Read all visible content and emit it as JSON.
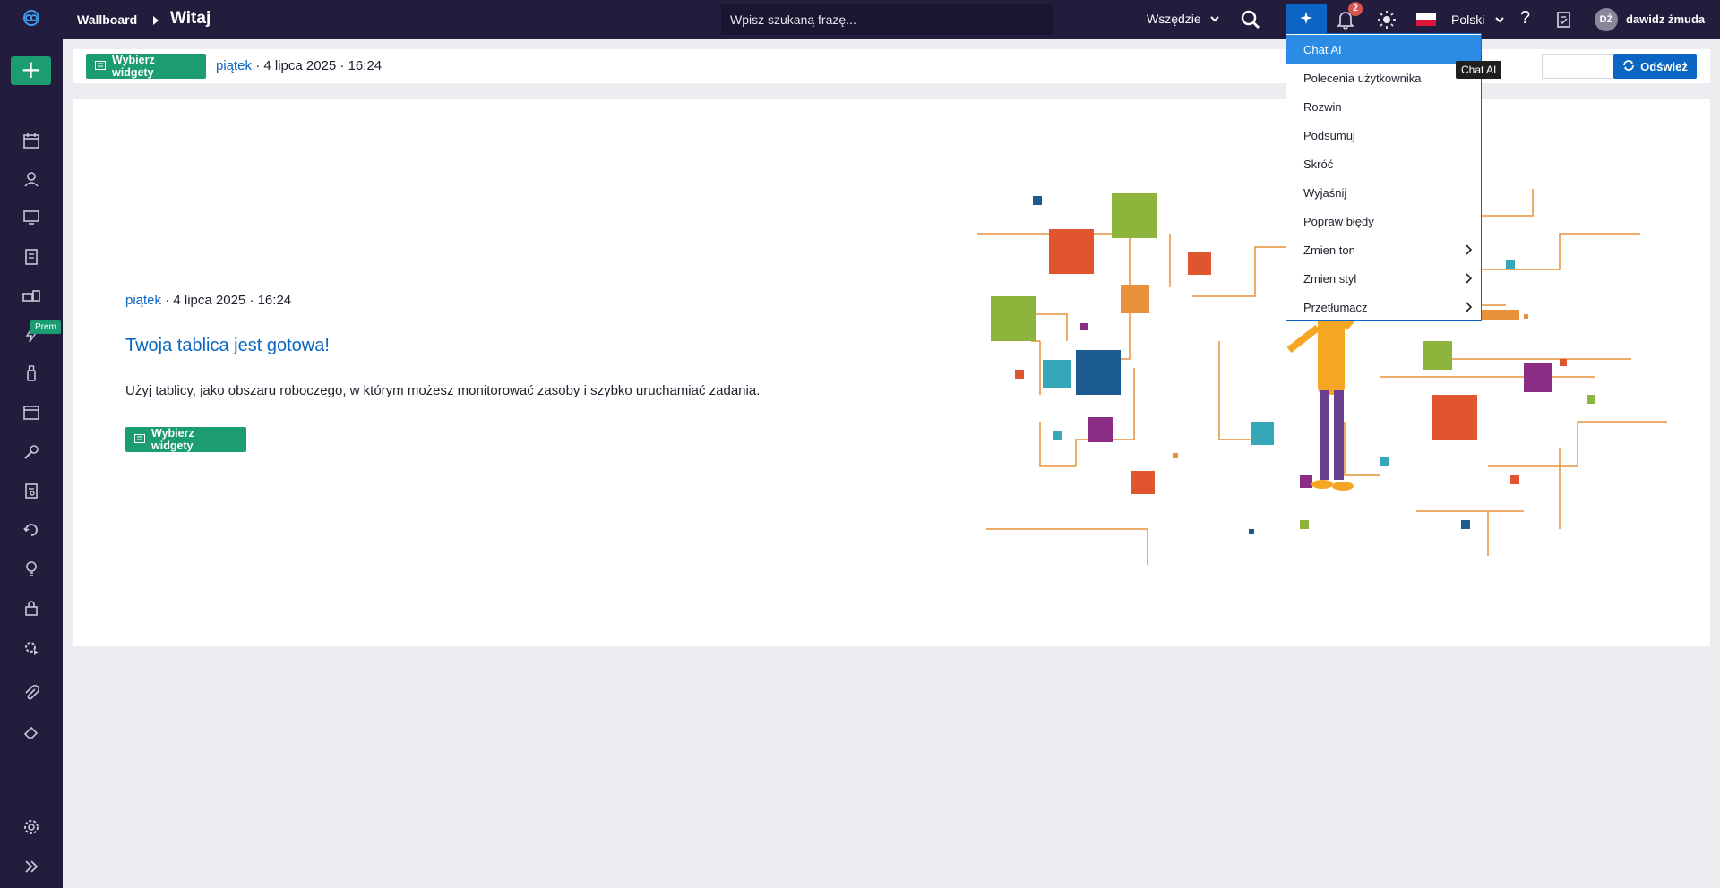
{
  "header": {
    "breadcrumb_root": "Wallboard",
    "breadcrumb_current": "Witaj",
    "search_placeholder": "Wpisz szukaną frazę...",
    "search_scope": "Wszędzie",
    "notification_count": "2",
    "language": "Polski",
    "help": "?",
    "user_initials": "DŻ",
    "user_name": "dawidz żmuda"
  },
  "sidebar": {
    "add": "+",
    "prem_badge": "Prem",
    "icons": [
      "calendar-icon",
      "user-icon",
      "monitor-icon",
      "document-icon",
      "network-icon",
      "lightning-icon",
      "usb-icon",
      "window-icon",
      "wrench-icon",
      "clipboard-icon",
      "refresh-icon",
      "lightbulb-icon",
      "lock-icon",
      "gear-play-icon",
      "paperclip-icon",
      "eraser-icon",
      "settings-icon",
      "expand-icon"
    ]
  },
  "toolbar": {
    "choose_widgets": "Wybierz widgety",
    "day": "piątek",
    "date_rest": " · 4 lipca 2025 · 16:24",
    "refresh": "Odśwież"
  },
  "welcome": {
    "day": "piątek",
    "date_rest": " · 4 lipca 2025 · 16:24",
    "title": "Twoja tablica jest gotowa!",
    "description": "Użyj tablicy, jako obszaru roboczego, w którym możesz monitorować zasoby i szybko uruchamiać zadania.",
    "button": "Wybierz widgety"
  },
  "ai_menu": {
    "tooltip": "Chat AI",
    "items": [
      {
        "label": "Chat AI"
      },
      {
        "label": "Polecenia użytkownika"
      },
      {
        "label": "Rozwin"
      },
      {
        "label": "Podsumuj"
      },
      {
        "label": "Skróć"
      },
      {
        "label": "Wyjaśnij"
      },
      {
        "label": "Popraw błędy"
      },
      {
        "label": "Zmien ton"
      },
      {
        "label": "Zmien styl"
      },
      {
        "label": "Przetłumacz"
      }
    ]
  },
  "colors": {
    "sidebar": "#241c3d",
    "accent_green": "#1c9c73",
    "accent_blue": "#0a66c2",
    "menu_active": "#2b8ce6"
  }
}
